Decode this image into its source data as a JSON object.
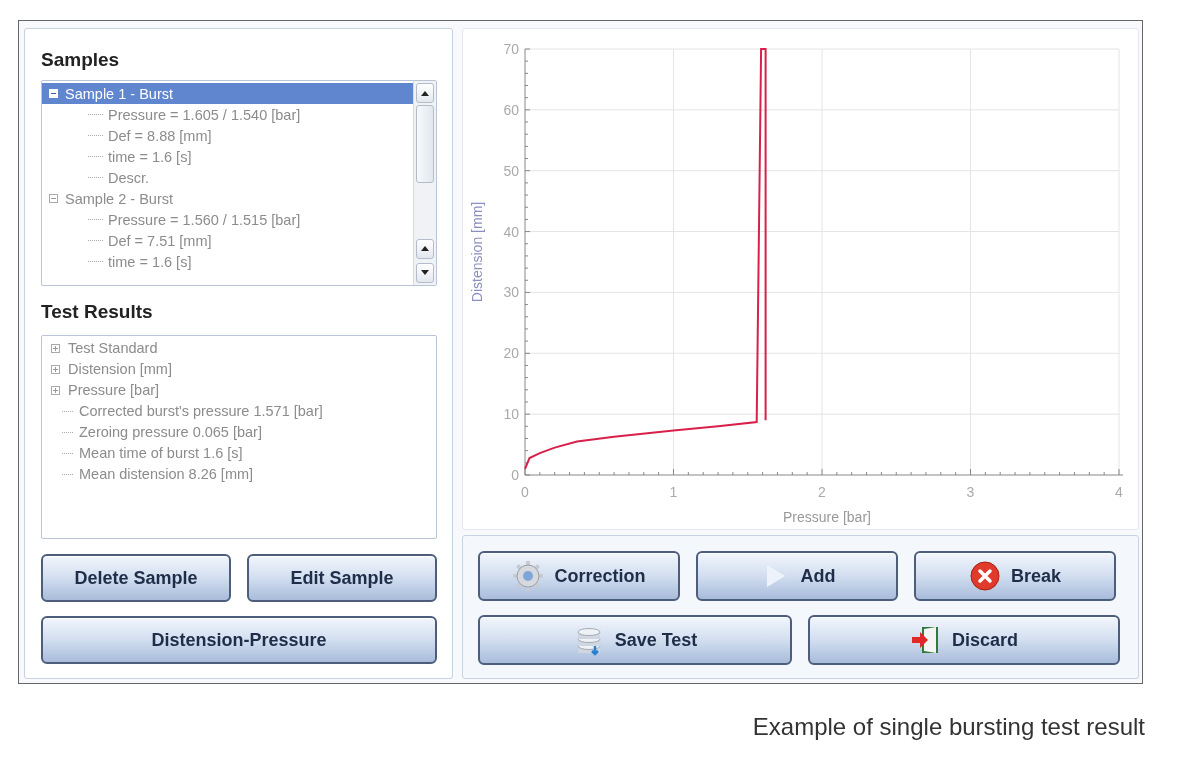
{
  "samples": {
    "title": "Samples",
    "items": [
      {
        "label": "Sample 1 - Burst",
        "expanded": true,
        "selected": true,
        "children": [
          {
            "label": "Pressure = 1.605 / 1.540 [bar]"
          },
          {
            "label": "Def = 8.88 [mm]"
          },
          {
            "label": "time = 1.6 [s]"
          },
          {
            "label": "Descr."
          }
        ]
      },
      {
        "label": "Sample 2 - Burst",
        "expanded": true,
        "selected": false,
        "children": [
          {
            "label": "Pressure = 1.560 / 1.515 [bar]"
          },
          {
            "label": "Def = 7.51 [mm]"
          },
          {
            "label": "time = 1.6 [s]"
          }
        ]
      }
    ]
  },
  "test_results": {
    "title": "Test Results",
    "items": [
      {
        "kind": "group",
        "expanded": false,
        "label": "Test Standard"
      },
      {
        "kind": "group",
        "expanded": false,
        "label": "Distension [mm]"
      },
      {
        "kind": "group",
        "expanded": false,
        "label": "Pressure [bar]"
      },
      {
        "kind": "leaf",
        "label": "Corrected burst's pressure 1.571 [bar]"
      },
      {
        "kind": "leaf",
        "label": "Zeroing pressure 0.065 [bar]"
      },
      {
        "kind": "leaf",
        "label": "Mean time of burst 1.6 [s]"
      },
      {
        "kind": "leaf",
        "label": "Mean distension 8.26 [mm]"
      }
    ]
  },
  "sample_buttons": [
    {
      "label": "Delete Sample"
    },
    {
      "label": "Edit Sample"
    },
    {
      "label": "Distension-Pressure"
    }
  ],
  "chart": {
    "chart_data": {
      "type": "line",
      "grid": true,
      "xlabel": "Pressure [bar]",
      "ylabel": "Distension [mm]",
      "xlim": [
        0,
        4
      ],
      "ylim": [
        0,
        70
      ],
      "xticks": [
        0,
        1,
        2,
        3,
        4
      ],
      "yticks": [
        0,
        10,
        20,
        30,
        40,
        50,
        60,
        70
      ],
      "x": [
        0,
        0.03,
        0.1,
        0.2,
        0.35,
        0.6,
        1,
        1.3,
        1.56,
        1.59,
        1.62,
        1.62
      ],
      "series": [
        {
          "color": "#d8204a",
          "values": [
            1,
            2.8,
            3.6,
            4.5,
            5.5,
            6.3,
            7.3,
            8,
            8.7,
            70,
            70,
            9
          ]
        }
      ]
    }
  },
  "action_buttons": [
    {
      "label": "Correction",
      "kind": "gear"
    },
    {
      "label": "Add",
      "kind": "play"
    },
    {
      "label": "Break",
      "kind": "cancel"
    },
    {
      "label": "Save Test",
      "kind": "database"
    },
    {
      "label": "Discard",
      "kind": "exit"
    }
  ],
  "caption": "Example of single bursting test result"
}
